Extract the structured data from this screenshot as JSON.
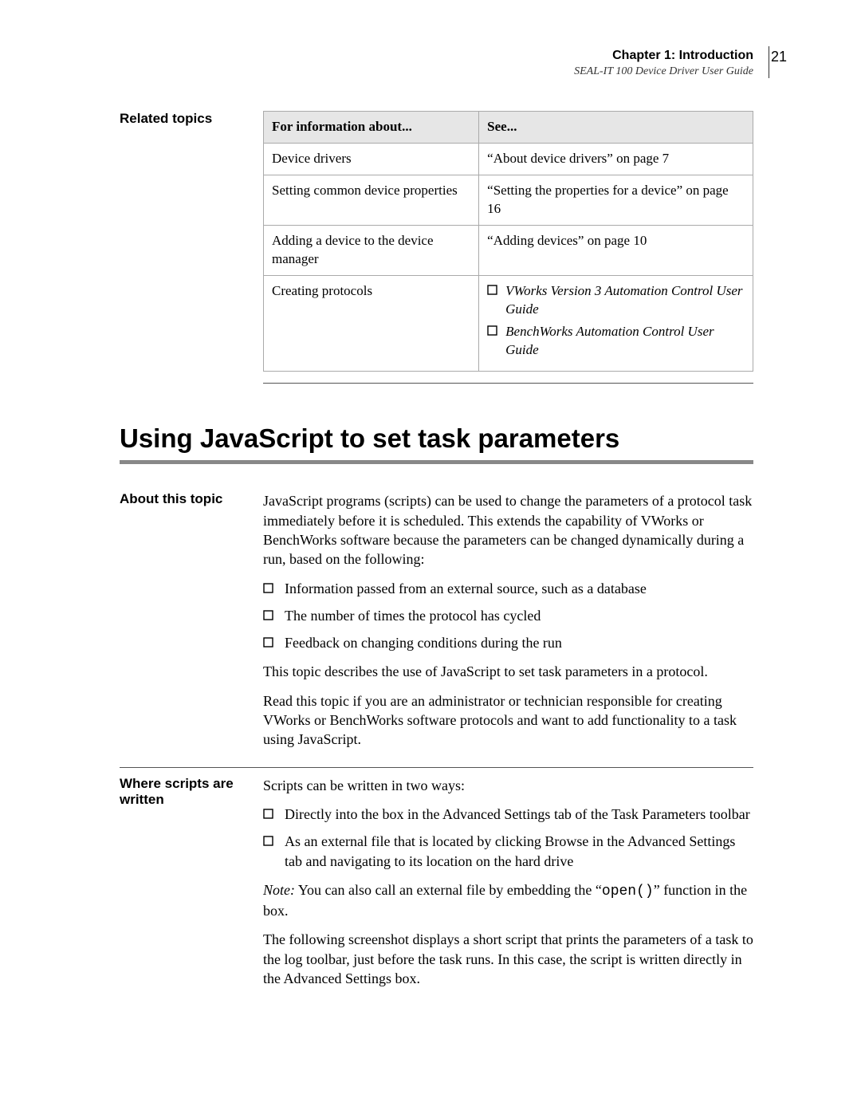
{
  "header": {
    "chapter": "Chapter 1: Introduction",
    "guide": "SEAL-IT 100 Device Driver User Guide",
    "page_number": "21"
  },
  "related": {
    "label": "Related topics",
    "cols": {
      "left": "For information about...",
      "right": "See..."
    },
    "rows": [
      {
        "about": "Device drivers",
        "see": "“About device drivers” on page 7"
      },
      {
        "about": "Setting common device properties",
        "see": "“Setting the properties for a device” on page 16"
      },
      {
        "about": "Adding a device to the device manager",
        "see": "“Adding devices” on page 10"
      }
    ],
    "protocols_about": "Creating protocols",
    "protocols_guides": [
      "VWorks Version 3 Automation Control User Guide",
      "BenchWorks Automation Control User Guide"
    ]
  },
  "section_title": "Using JavaScript to set task parameters",
  "about": {
    "label": "About this topic",
    "intro": "JavaScript programs (scripts) can be used to change the parameters of a protocol task immediately before it is scheduled. This extends the capability of VWorks or BenchWorks software because the parameters can be changed dynamically during a run, based on the following:",
    "bullets": [
      "Information passed from an external source, such as a database",
      "The number of times the protocol has cycled",
      "Feedback on changing conditions during the run"
    ],
    "p2": "This topic describes the use of JavaScript to set task parameters in a protocol.",
    "p3": "Read this topic if you are an administrator or technician responsible for creating VWorks or BenchWorks software protocols and want to add functionality to a task using JavaScript."
  },
  "where": {
    "label": "Where scripts are written",
    "intro": "Scripts can be written in two ways:",
    "bullets": [
      "Directly into the box in the Advanced Settings tab of the Task Parameters toolbar",
      "As an external file that is located by clicking Browse in the Advanced Settings tab and navigating to its location on the hard drive"
    ],
    "note_label": "Note:",
    "note_pre": " You can also call an external file by embedding the “",
    "note_code": "open()",
    "note_post": "” function in the box.",
    "p2": "The following screenshot displays a short script that prints the parameters of a task to the log toolbar, just before the task runs. In this case, the script is written directly in the Advanced Settings box."
  }
}
